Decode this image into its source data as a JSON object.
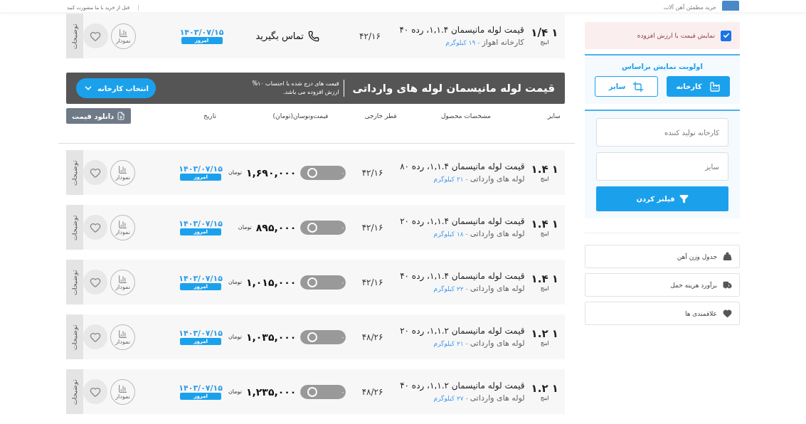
{
  "header": {
    "logo_tagline": "خرید مطمئن آهن آلات",
    "consult": "قبل از خرید با ما مشورت کنید"
  },
  "rows_top": [
    {
      "kind": "contact",
      "size": "۱ ۱/۴",
      "size_unit": "اینچ",
      "title": "قیمت لوله مانیسمان ۱,۱.۴، رده ۴۰",
      "source": "کارخانه اهواز",
      "weight": "- ۱۹ کیلوگرم",
      "diameter": "۴۲/۱۶",
      "contact": "تماس بگیرید",
      "date": "۱۴۰۳/۰۷/۱۵",
      "date_badge": "امروز",
      "chart_label": "نمودار",
      "note_tab": "توضیحات"
    }
  ],
  "section": {
    "title": "قیمت لوله مانیسمان لوله های وارداتی",
    "note": "قیمت های درج شده با احتساب ۱۰% ارزش افزوده می باشد.",
    "select_button": "انتخاب کارخانه"
  },
  "columns": [
    "سایز",
    "مشخصات محصول",
    "قطر خارجی",
    "قیمت‌ونوسان(تومان)",
    "تاریخ"
  ],
  "download_button": "دانلود قیمت",
  "rows": [
    {
      "kind": "price",
      "size": "۱ ۱.۴",
      "size_unit": "اینچ",
      "title": "قیمت لوله مانیسمان ۱,۱.۴، رده ۸۰",
      "source": "لوله های وارداتی",
      "weight": "- ۳۱ کیلوگرم",
      "diameter": "۴۲/۱۶",
      "change": "۰",
      "price": "۱,۶۹۰,۰۰۰",
      "currency": "تومان",
      "date": "۱۴۰۳/۰۷/۱۵",
      "date_badge": "امروز",
      "chart_label": "نمودار",
      "note_tab": "توضیحات"
    },
    {
      "kind": "price",
      "size": "۱ ۱.۴",
      "size_unit": "اینچ",
      "title": "قیمت لوله مانیسمان ۱,۱.۴، رده ۲۰",
      "source": "لوله های وارداتی",
      "weight": "- ۱۸ کیلوگرم",
      "diameter": "۴۲/۱۶",
      "change": "۰",
      "price": "۸۹۵,۰۰۰",
      "currency": "تومان",
      "date": "۱۴۰۳/۰۷/۱۵",
      "date_badge": "امروز",
      "chart_label": "نمودار",
      "note_tab": "توضیحات"
    },
    {
      "kind": "price",
      "size": "۱ ۱.۴",
      "size_unit": "اینچ",
      "title": "قیمت لوله مانیسمان ۱,۱.۴، رده ۴۰",
      "source": "لوله های وارداتی",
      "weight": "- ۲۲ کیلوگرم",
      "diameter": "۴۲/۱۶",
      "change": "۰",
      "price": "۱,۰۱۵,۰۰۰",
      "currency": "تومان",
      "date": "۱۴۰۳/۰۷/۱۵",
      "date_badge": "امروز",
      "chart_label": "نمودار",
      "note_tab": "توضیحات"
    },
    {
      "kind": "price",
      "size": "۱ ۱.۲",
      "size_unit": "اینچ",
      "title": "قیمت لوله مانیسمان ۱,۱.۲، رده ۲۰",
      "source": "لوله های وارداتی",
      "weight": "- ۲۱ کیلوگرم",
      "diameter": "۴۸/۲۶",
      "change": "۰",
      "price": "۱,۰۳۵,۰۰۰",
      "currency": "تومان",
      "date": "۱۴۰۳/۰۷/۱۵",
      "date_badge": "امروز",
      "chart_label": "نمودار",
      "note_tab": "توضیحات"
    },
    {
      "kind": "price",
      "size": "۱ ۱.۲",
      "size_unit": "اینچ",
      "title": "قیمت لوله مانیسمان ۱,۱.۲، رده ۴۰",
      "source": "لوله های وارداتی",
      "weight": "- ۲۷ کیلوگرم",
      "diameter": "۴۸/۲۶",
      "change": "۰",
      "price": "۱,۲۳۵,۰۰۰",
      "currency": "تومان",
      "date": "۱۴۰۳/۰۷/۱۵",
      "date_badge": "امروز",
      "chart_label": "نمودار",
      "note_tab": "توضیحات"
    }
  ],
  "sidebar": {
    "vat_toggle": {
      "label": "نمایش قیمت با ارزش افزوده",
      "checked": true
    },
    "priority": {
      "title": "اولویت نمایش براساس",
      "options": [
        {
          "label": "کارخانه",
          "selected": true
        },
        {
          "label": "سایز",
          "selected": false
        }
      ]
    },
    "filter": {
      "fields": [
        {
          "placeholder": "کارخانه تولید کننده"
        },
        {
          "placeholder": "سایز"
        }
      ],
      "button": "فیلتر کردن"
    },
    "links": [
      {
        "label": "جدول وزن آهن"
      },
      {
        "label": "برآورد هزینه حمل"
      },
      {
        "label": "علاقمندی ها"
      }
    ]
  }
}
